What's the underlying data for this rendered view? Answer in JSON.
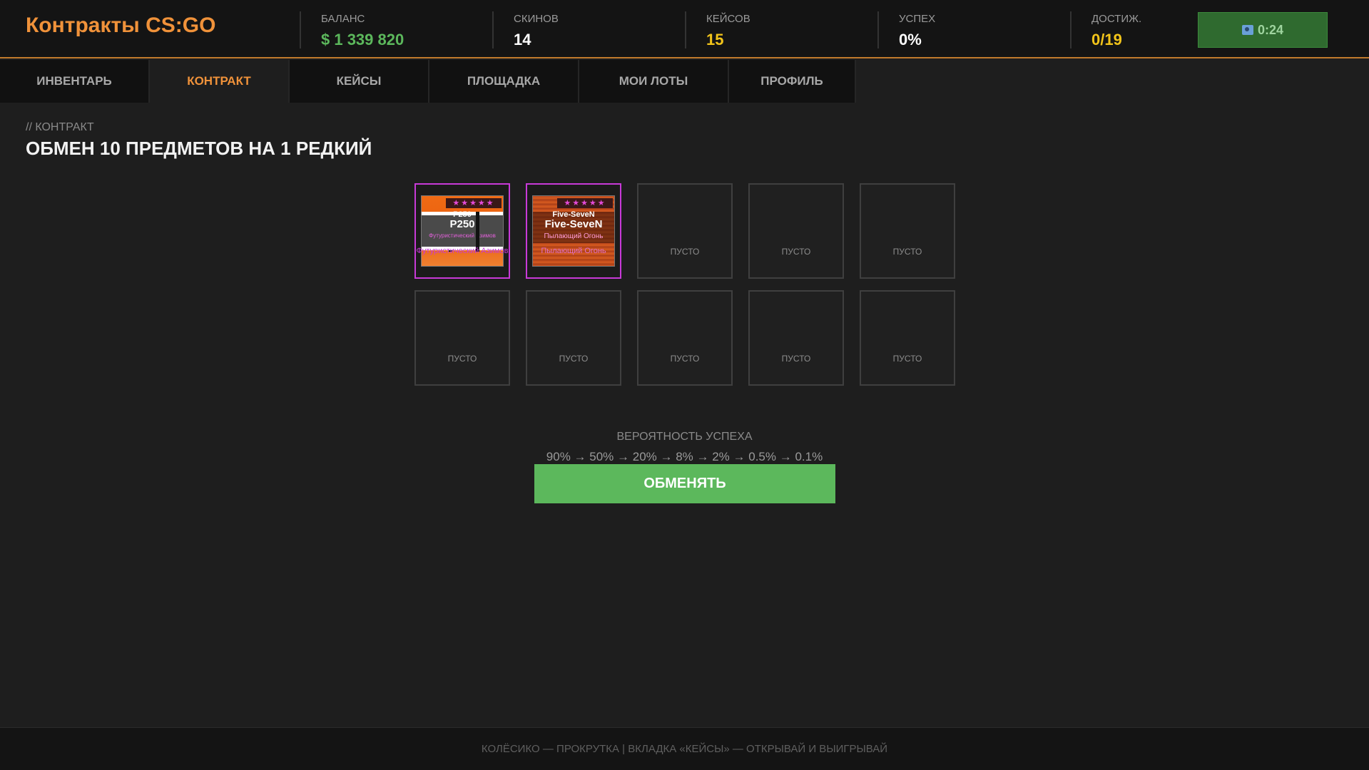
{
  "header": {
    "title": "Контракты CS:GO",
    "stats": [
      {
        "label": "БАЛАНС",
        "value": "$ 1 339 820",
        "color": "#5cb85c"
      },
      {
        "label": "СКИНОВ",
        "value": "14",
        "color": "#ffffff"
      },
      {
        "label": "КЕЙСОВ",
        "value": "15",
        "color": "#f2c41a"
      },
      {
        "label": "УСПЕХ",
        "value": "0%",
        "color": "#ffffff"
      },
      {
        "label": "ДОСТИЖ.",
        "value": "0/19",
        "color": "#f2c41a"
      }
    ],
    "timer": "0:24"
  },
  "tabs": [
    {
      "label": "ИНВЕНТАРЬ",
      "active": false
    },
    {
      "label": "КОНТРАКТ",
      "active": true
    },
    {
      "label": "КЕЙСЫ",
      "active": false
    },
    {
      "label": "ПЛОЩАДКА",
      "active": false
    },
    {
      "label": "МОИ ЛОТЫ",
      "active": false
    },
    {
      "label": "ПРОФИЛЬ",
      "active": false
    }
  ],
  "main": {
    "breadcrumb": "// КОНТРАКТ",
    "title": "ОБМЕН 10 ПРЕДМЕТОВ НА 1 РЕДКИЙ",
    "slots": [
      {
        "filled": true,
        "weapon_small": "P250",
        "weapon": "P250",
        "skin": "Футуристический Азимов",
        "footer": "Футуристический Азимов",
        "stars": "★★★★★",
        "style": "p250"
      },
      {
        "filled": true,
        "weapon_small": "Five-SeveN",
        "weapon": "Five-SeveN",
        "skin": "Пылающий Огонь",
        "footer": "Пылающий Огонь",
        "stars": "★★★★★",
        "style": "fiveseven"
      },
      {
        "filled": false,
        "empty_label": "ПУСТО"
      },
      {
        "filled": false,
        "empty_label": "ПУСТО"
      },
      {
        "filled": false,
        "empty_label": "ПУСТО"
      },
      {
        "filled": false,
        "empty_label": "ПУСТО"
      },
      {
        "filled": false,
        "empty_label": "ПУСТО"
      },
      {
        "filled": false,
        "empty_label": "ПУСТО"
      },
      {
        "filled": false,
        "empty_label": "ПУСТО"
      },
      {
        "filled": false,
        "empty_label": "ПУСТО"
      }
    ],
    "probability_label": "ВЕРОЯТНОСТЬ УСПЕХА",
    "probability_chain": "90% → 50% → 20% → 8% → 2% → 0.5% → 0.1%",
    "exchange_button": "ОБМЕНЯТЬ"
  },
  "footer": {
    "hint": "КОЛЁСИКО — ПРОКРУТКА | ВКЛАДКА «КЕЙСЫ» — ОТКРЫВАЙ И ВЫИГРЫВАЙ"
  }
}
